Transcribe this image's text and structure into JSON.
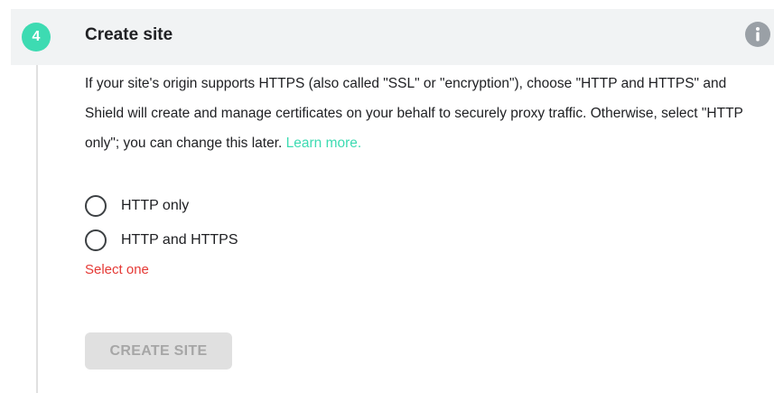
{
  "step": {
    "number": "4",
    "title": "Create site",
    "info_icon": "info-icon"
  },
  "description": {
    "text": "If your site's origin supports HTTPS (also called \"SSL\" or \"encryption\"), choose \"HTTP and HTTPS\" and Shield will create and manage certificates on your behalf to securely proxy traffic. Otherwise, select \"HTTP only\"; you can change this later.",
    "link_text": "Learn more."
  },
  "protocol_options": [
    {
      "label": "HTTP only",
      "selected": false
    },
    {
      "label": "HTTP and HTTPS",
      "selected": false
    }
  ],
  "validation": {
    "error": "Select one"
  },
  "actions": {
    "create_label": "CREATE SITE",
    "create_enabled": false
  },
  "colors": {
    "accent": "#3ddbb2",
    "error": "#e53935",
    "header_bg": "#f1f3f4",
    "button_disabled_bg": "#e0e0e0",
    "button_disabled_text": "#a6a6a6"
  }
}
